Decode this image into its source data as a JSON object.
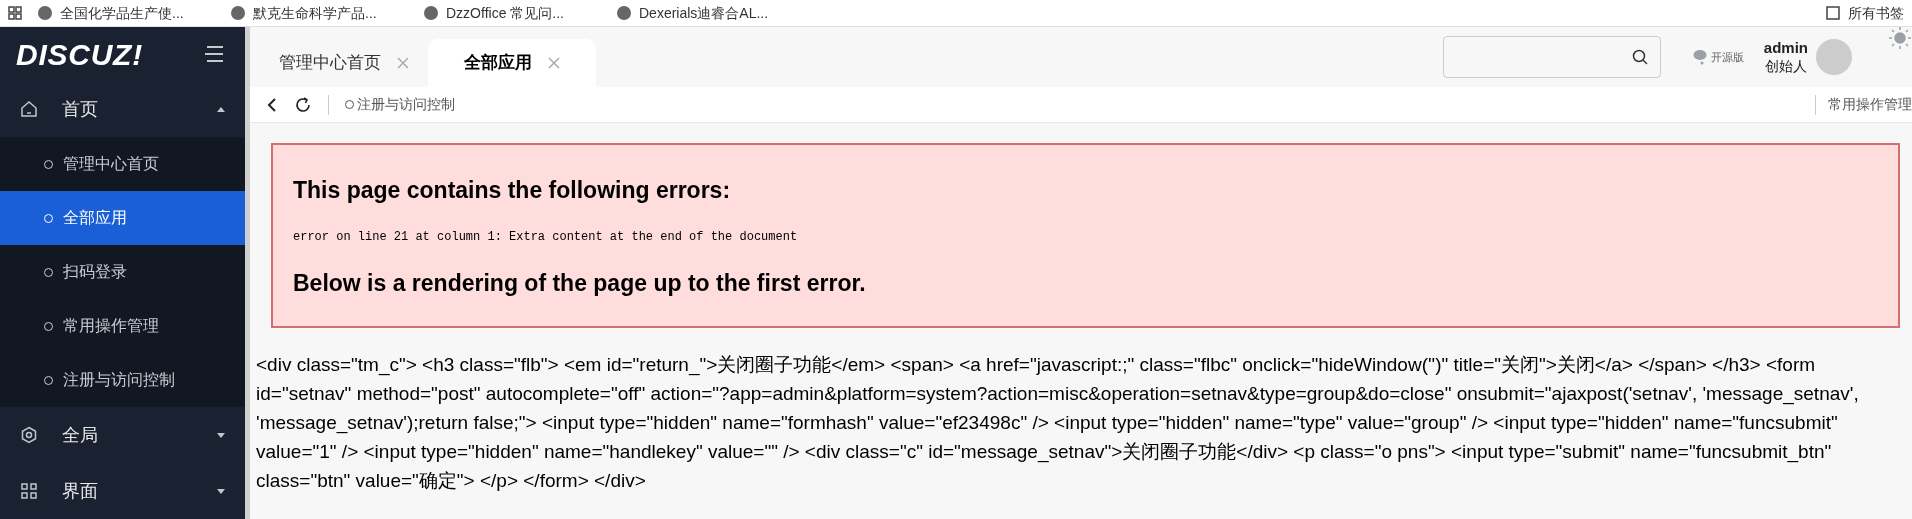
{
  "bookmarks_bar": {
    "items": [
      {
        "label": "全国化学品生产使..."
      },
      {
        "label": "默克生命科学产品..."
      },
      {
        "label": "DzzOffice 常见问..."
      },
      {
        "label": "Dexerials迪睿合AL..."
      }
    ],
    "all_bookmarks": "所有书签"
  },
  "sidebar": {
    "logo": "DISCUZ!",
    "items": [
      {
        "label": "首页",
        "expanded": true,
        "children": [
          {
            "label": "管理中心首页",
            "selected": false
          },
          {
            "label": "全部应用",
            "selected": true
          },
          {
            "label": "扫码登录",
            "selected": false
          },
          {
            "label": "常用操作管理",
            "selected": false
          },
          {
            "label": "注册与访问控制",
            "selected": false
          }
        ]
      },
      {
        "label": "全局",
        "expanded": false
      },
      {
        "label": "界面",
        "expanded": false
      }
    ]
  },
  "tabs": [
    {
      "label": "管理中心首页",
      "selected": false
    },
    {
      "label": "全部应用",
      "selected": true
    }
  ],
  "header": {
    "edition": "开源版",
    "user": "admin",
    "role": "创始人"
  },
  "breadcrumb": {
    "current": "注册与访问控制",
    "right_link": "常用操作管理"
  },
  "error_box": {
    "title": "This page contains the following errors:",
    "message": "error on line 21 at column 1: Extra content at the end of the document",
    "footer": "Below is a rendering of the page up to the first error."
  },
  "rendered_source": "<div class=\"tm_c\"> <h3 class=\"flb\"> <em id=\"return_\">关闭圈子功能</em> <span> <a href=\"javascript:;\" class=\"flbc\" onclick=\"hideWindow('')\" title=\"关闭\">关闭</a> </span> </h3> <form id=\"setnav\" method=\"post\" autocomplete=\"off\" action=\"?app=admin&platform=system?action=misc&operation=setnav&type=group&do=close\" onsubmit=\"ajaxpost('setnav', 'message_setnav', 'message_setnav');return false;\"> <input type=\"hidden\" name=\"formhash\" value=\"ef23498c\" /> <input type=\"hidden\" name=\"type\" value=\"group\" /> <input type=\"hidden\" name=\"funcsubmit\" value=\"1\" /> <input type=\"hidden\" name=\"handlekey\" value=\"\" /> <div class=\"c\" id=\"message_setnav\">关闭圈子功能</div> <p class=\"o pns\"> <input type=\"submit\" name=\"funcsubmit_btn\" class=\"btn\" value=\"确定\"> </p> </form> </div>"
}
